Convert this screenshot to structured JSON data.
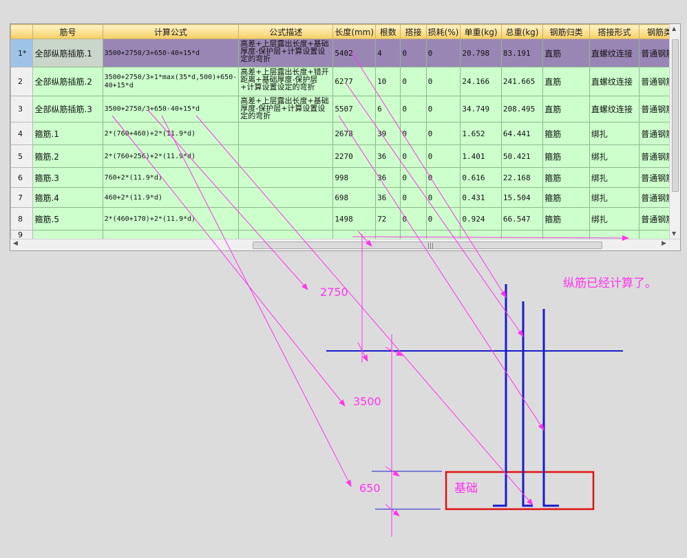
{
  "table": {
    "headers": [
      "",
      "筋号",
      "计算公式",
      "公式描述",
      "长度(mm)",
      "根数",
      "搭接",
      "损耗(%)",
      "单重(kg)",
      "总重(kg)",
      "钢筋归类",
      "搭接形式",
      "钢筋类"
    ],
    "rows": [
      {
        "idx": "1*",
        "name": "全部纵筋插筋.1",
        "formula": "3500+2750/3+650-40+15*d",
        "desc": "高差+上层露出长度+基础厚度-保护层+计算设置设定的弯折",
        "length": "5402",
        "count": "4",
        "lap": "0",
        "loss": "0",
        "unit_weight": "20.798",
        "total_weight": "83.191",
        "category": "直筋",
        "joint": "直螺纹连接",
        "type": "普通钢筋"
      },
      {
        "idx": "2",
        "name": "全部纵筋插筋.2",
        "formula": "3500+2750/3+1*max(35*d,500)+650-40+15*d",
        "desc": "高差+上层露出长度+错开距离+基础厚度-保护层+计算设置设定的弯折",
        "length": "6277",
        "count": "10",
        "lap": "0",
        "loss": "0",
        "unit_weight": "24.166",
        "total_weight": "241.665",
        "category": "直筋",
        "joint": "直螺纹连接",
        "type": "普通钢筋"
      },
      {
        "idx": "3",
        "name": "全部纵筋插筋.3",
        "formula": "3500+2750/3+650-40+15*d",
        "desc": "高差+上层露出长度+基础厚度-保护层+计算设置设定的弯折",
        "length": "5507",
        "count": "6",
        "lap": "0",
        "loss": "0",
        "unit_weight": "34.749",
        "total_weight": "208.495",
        "category": "直筋",
        "joint": "直螺纹连接",
        "type": "普通钢筋"
      },
      {
        "idx": "4",
        "name": "箍筋.1",
        "formula": "2*(760+460)+2*(11.9*d)",
        "desc": "",
        "length": "2678",
        "count": "39",
        "lap": "0",
        "loss": "0",
        "unit_weight": "1.652",
        "total_weight": "64.441",
        "category": "箍筋",
        "joint": "绑扎",
        "type": "普通钢筋"
      },
      {
        "idx": "5",
        "name": "箍筋.2",
        "formula": "2*(760+256)+2*(11.9*d)",
        "desc": "",
        "length": "2270",
        "count": "36",
        "lap": "0",
        "loss": "0",
        "unit_weight": "1.401",
        "total_weight": "50.421",
        "category": "箍筋",
        "joint": "绑扎",
        "type": "普通钢筋"
      },
      {
        "idx": "6",
        "name": "箍筋.3",
        "formula": "760+2*(11.9*d)",
        "desc": "",
        "length": "998",
        "count": "36",
        "lap": "0",
        "loss": "0",
        "unit_weight": "0.616",
        "total_weight": "22.168",
        "category": "箍筋",
        "joint": "绑扎",
        "type": "普通钢筋"
      },
      {
        "idx": "7",
        "name": "箍筋.4",
        "formula": "460+2*(11.9*d)",
        "desc": "",
        "length": "698",
        "count": "36",
        "lap": "0",
        "loss": "0",
        "unit_weight": "0.431",
        "total_weight": "15.504",
        "category": "箍筋",
        "joint": "绑扎",
        "type": "普通钢筋"
      },
      {
        "idx": "8",
        "name": "箍筋.5",
        "formula": "2*(460+170)+2*(11.9*d)",
        "desc": "",
        "length": "1498",
        "count": "72",
        "lap": "0",
        "loss": "0",
        "unit_weight": "0.924",
        "total_weight": "66.547",
        "category": "箍筋",
        "joint": "绑扎",
        "type": "普通钢筋"
      },
      {
        "idx": "9",
        "name": "",
        "formula": "",
        "desc": "",
        "length": "",
        "count": "",
        "lap": "",
        "loss": "",
        "unit_weight": "",
        "total_weight": "",
        "category": "",
        "joint": "",
        "type": ""
      }
    ]
  },
  "annotations": {
    "dim_2750": "2750",
    "dim_3500": "3500",
    "dim_650": "650",
    "foundation_label": "基础",
    "note": "纵筋已经计算了。",
    "colors": {
      "magenta": "#ff33ee",
      "rebar_blue": "#1a1acc",
      "foundation_red": "#e01010"
    }
  }
}
